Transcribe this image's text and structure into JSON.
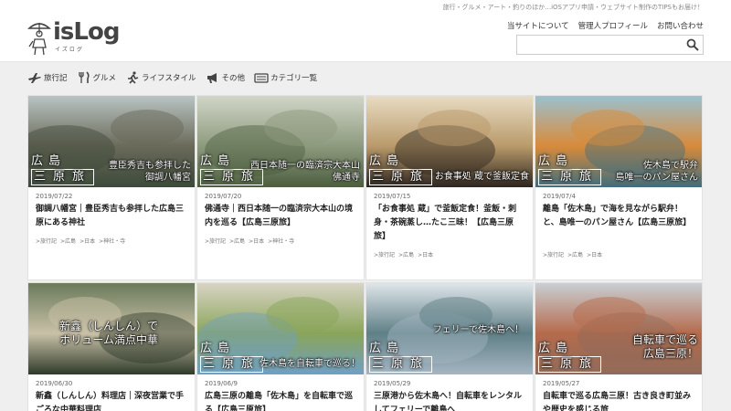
{
  "site": {
    "tagline": "旅行・グルメ・アート・釣りのほか…iOSアプリ申請・ウェブサイト制作のTIPSもお届け！",
    "logo_main": "isLog",
    "logo_sub": "イズログ"
  },
  "topnav": [
    {
      "label": "当サイトについて"
    },
    {
      "label": "管理人プロフィール"
    },
    {
      "label": "お問い合わせ"
    }
  ],
  "search": {
    "placeholder": ""
  },
  "categories": [
    {
      "label": "旅行記",
      "icon": "airplane-icon"
    },
    {
      "label": "グルメ",
      "icon": "utensils-icon"
    },
    {
      "label": "ライフスタイル",
      "icon": "running-person-icon"
    },
    {
      "label": "その他",
      "icon": "megaphone-icon"
    },
    {
      "label": "カテゴリ一覧",
      "icon": "keyboard-icon"
    }
  ],
  "posts": [
    {
      "date": "2019/07/22",
      "title": "御調八幡宮｜豊臣秀吉も参拝した広島三原にある神社",
      "tags": [
        ">旅行記",
        ">広島",
        ">日本",
        ">神社・寺"
      ],
      "series": [
        "広島",
        "三原旅"
      ],
      "overlay": [
        "豊臣秀吉も参拝した",
        "御調八幡宮"
      ],
      "colors": [
        "#3d4a3a",
        "#6a6a5a",
        "#b9c4c2"
      ]
    },
    {
      "date": "2019/07/20",
      "title": "佛通寺｜西日本随一の臨済宗大本山の境内を巡る【広島三原旅】",
      "tags": [
        ">旅行記",
        ">広島",
        ">日本",
        ">神社・寺"
      ],
      "series": [
        "広島",
        "三原旅"
      ],
      "overlay": [
        "西日本随一の臨済宗大本山",
        "佛通寺"
      ],
      "colors": [
        "#4c5e3f",
        "#8e9a7e",
        "#d0d6c8"
      ]
    },
    {
      "date": "2019/07/15",
      "title": "「お食事処 蔵」で釜飯定食！釜飯・刺身・茶碗蒸し…たこ三昧！【広島三原旅】",
      "tags": [
        ">旅行記",
        ">広島",
        ">日本"
      ],
      "series": [
        "広島",
        "三原旅"
      ],
      "overlay": [
        "お食事処 蔵で釜飯定食"
      ],
      "colors": [
        "#2d2520",
        "#b99a6a",
        "#e8dcc4"
      ]
    },
    {
      "date": "2019/07/4",
      "title": "離島「佐木島」で海を見ながら駅弁！と、島唯一のパン屋さん【広島三原旅】",
      "tags": [
        ">旅行記",
        ">広島",
        ">日本"
      ],
      "series": [
        "広島",
        "三原旅"
      ],
      "overlay": [
        "佐木島で駅弁",
        "島唯一のパン屋さん"
      ],
      "colors": [
        "#3f6d7e",
        "#d88b3a",
        "#9cc0cf"
      ]
    },
    {
      "date": "2019/06/30",
      "title": "新鑫（しんしん）料理店｜深夜営業で手ごろな中華料理店",
      "tags": [],
      "series": [],
      "overlay": [
        "新鑫（しんしん）で",
        "ボリューム満点中華"
      ],
      "colors": [
        "#2f3a2a",
        "#c9c1a8",
        "#6a7a5a"
      ]
    },
    {
      "date": "2019/06/9",
      "title": "広島三原の離島「佐木島」を自転車で巡る【広島三原旅】",
      "tags": [],
      "series": [
        "広島",
        "三原旅"
      ],
      "overlay": [
        "佐木島を自転車で巡る！"
      ],
      "colors": [
        "#6f9fc4",
        "#8aa55a",
        "#d8d4c4"
      ]
    },
    {
      "date": "2019/05/29",
      "title": "三原港から佐木島へ！自転車をレンタルしてフェリーで離島へ",
      "tags": [],
      "series": [
        "広島",
        "三原旅"
      ],
      "overlay": [
        "フェリーで佐木島へ！"
      ],
      "colors": [
        "#a5b6c2",
        "#5f7f86",
        "#dfe6ea"
      ]
    },
    {
      "date": "2019/05/27",
      "title": "自転車で巡る広島三原！古き良き町並みや歴史を感じる旅",
      "tags": [],
      "series": [
        "広島",
        "三原旅"
      ],
      "overlay": [
        "自転車で巡る",
        "広島三原！"
      ],
      "colors": [
        "#8f6b5a",
        "#b56b4c",
        "#c9cfd4"
      ]
    }
  ]
}
